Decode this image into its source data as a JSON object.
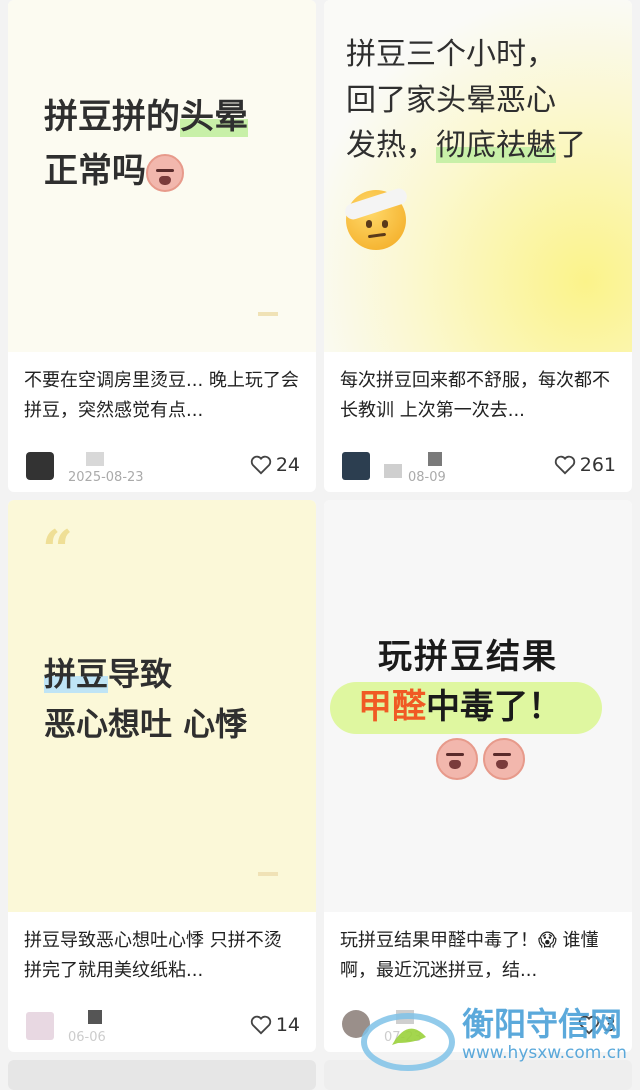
{
  "posts": [
    {
      "cover_line1_a": "拼豆拼的",
      "cover_line1_b": "头晕",
      "cover_line2": "正常吗",
      "caption": "不要在空调房里烫豆... 晚上玩了会拼豆，突然感觉有点...",
      "date": "2025-08-23",
      "likes": "24"
    },
    {
      "cover_line1": "拼豆三个小时，",
      "cover_line2": "回了家头晕恶心",
      "cover_line3_a": "发热，",
      "cover_line3_b": "彻底祛魅",
      "cover_line3_c": "了",
      "caption": "每次拼豆回来都不舒服，每次都不长教训 上次第一次去...",
      "date": "08-09",
      "likes": "261"
    },
    {
      "quote_mark": "“",
      "cover_line1_a": "拼豆",
      "cover_line1_b": "导致",
      "cover_line2": "恶心想吐 心悸",
      "caption": "拼豆导致恶心想吐心悸 只拼不烫 拼完了就用美纹纸粘...",
      "date": "06-06",
      "likes": "14"
    },
    {
      "cover_line1": "玩拼豆结果",
      "cover_line2_a": "甲醛",
      "cover_line2_b": "中毒了！",
      "caption": "玩拼豆结果甲醛中毒了！😱 谁懂啊，最近沉迷拼豆，结...",
      "date": "07-23",
      "likes": "3"
    }
  ],
  "watermark": {
    "name": "衡阳守信网",
    "url": "www.hysxw.com.cn"
  },
  "colors": {
    "highlight_green": "#c8f0a8",
    "highlight_blue": "#bfe4f5",
    "yellow_bg": "#fbf8d8"
  },
  "icons": [
    "heart-icon",
    "dizzy-face-emoji-icon",
    "bandaged-face-emoji-icon",
    "screaming-emoji-icon"
  ]
}
